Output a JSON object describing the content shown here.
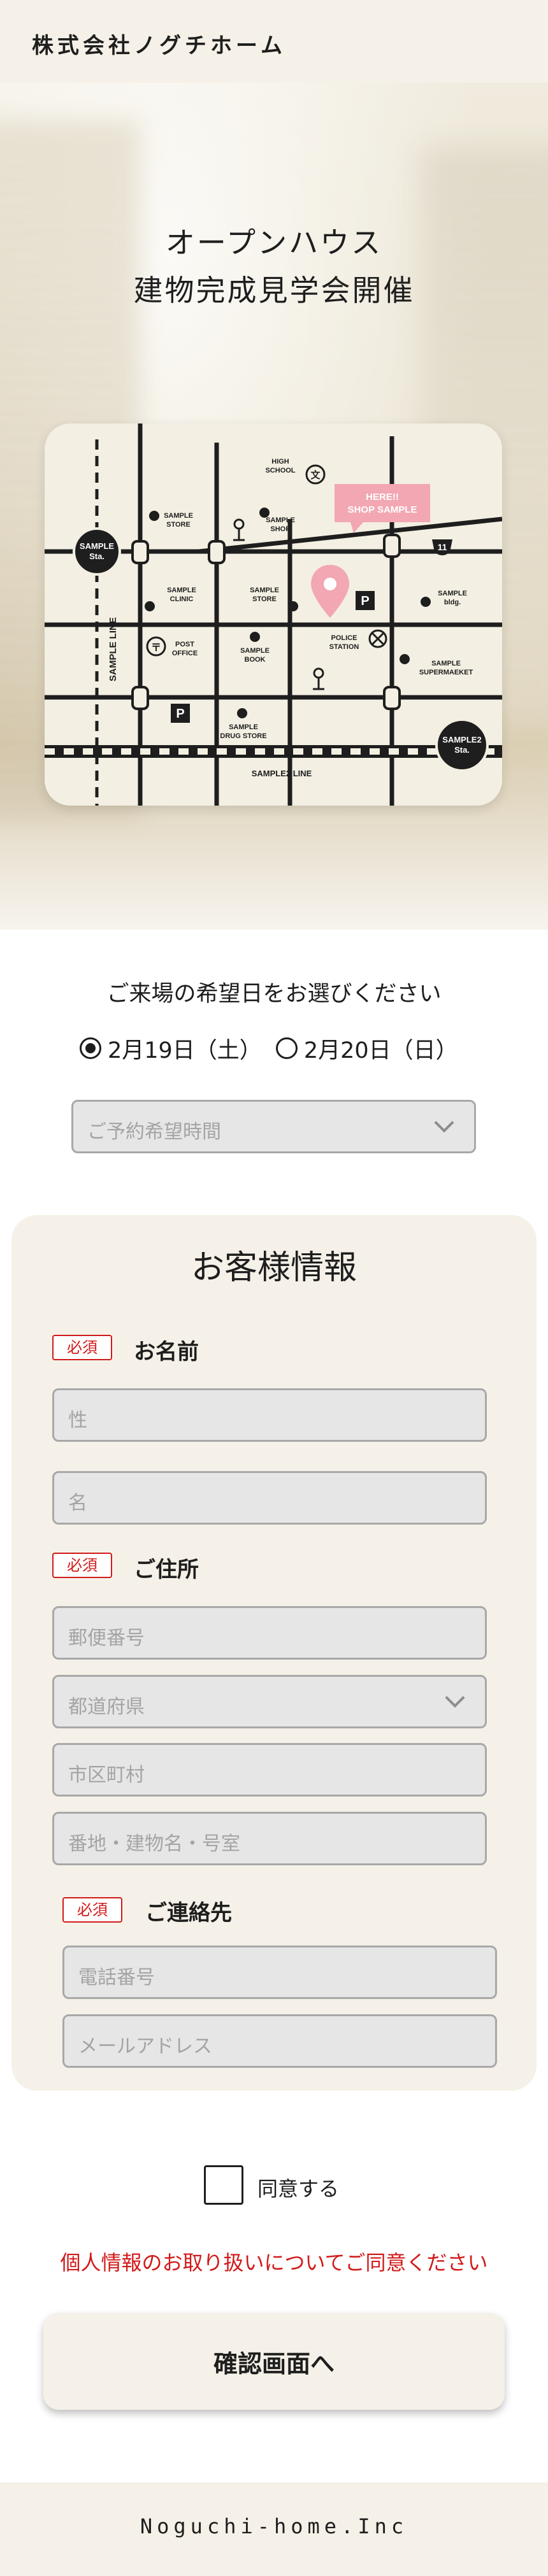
{
  "header": {
    "logo": "株式会社ノグチホーム"
  },
  "hero": {
    "line1": "オープンハウス",
    "line2": "建物完成見学会開催",
    "map": {
      "labels": {
        "sample_sta": [
          "SAMPLE",
          "Sta."
        ],
        "sample2_sta": [
          "SAMPLE2",
          "Sta."
        ],
        "sample_line": "SAMPLE LINE",
        "sample2_line": "SAMPLE2 LINE",
        "high_school": [
          "HIGH",
          "SCHOOL"
        ],
        "sample_store_1": [
          "SAMPLE",
          "STORE"
        ],
        "sample_shop": [
          "SAMPLE",
          "SHOP"
        ],
        "here": [
          "HERE!!",
          "SHOP SAMPLE"
        ],
        "route_number": "11",
        "sample_clinic": [
          "SAMPLE",
          "CLINIC"
        ],
        "sample_store_2": [
          "SAMPLE",
          "STORE"
        ],
        "sample_bldg": [
          "SAMPLE",
          "bldg."
        ],
        "post_office": [
          "POST",
          "OFFICE"
        ],
        "sample_book": [
          "SAMPLE",
          "BOOK"
        ],
        "police_station": [
          "POLICE",
          "STATION"
        ],
        "sample_supermarket": [
          "SAMPLE",
          "SUPERMAEKET"
        ],
        "sample_drug_store": [
          "SAMPLE",
          "DRUG STORE"
        ],
        "parking": "P"
      },
      "colors": {
        "pin": "#f2a7b2",
        "road": "#1e1e1e",
        "bg": "#f3efe2"
      }
    }
  },
  "date_section": {
    "question": "ご来場の希望日をお選びください",
    "options": [
      {
        "label": "2月19日（土）",
        "selected": true
      },
      {
        "label": "2月20日（日）",
        "selected": false
      }
    ],
    "time_placeholder": "ご予約希望時間"
  },
  "customer_info": {
    "title": "お客様情報",
    "required_badge": "必須",
    "name": {
      "label": "お名前",
      "last_placeholder": "性",
      "first_placeholder": "名"
    },
    "address": {
      "label": "ご住所",
      "postal_placeholder": "郵便番号",
      "prefecture_placeholder": "都道府県",
      "city_placeholder": "市区町村",
      "street_placeholder": "番地・建物名・号室"
    },
    "contact": {
      "label": "ご連絡先",
      "phone_placeholder": "電話番号",
      "email_placeholder": "メールアドレス"
    }
  },
  "agreement": {
    "checkbox_label": "同意する",
    "warning": "個人情報のお取り扱いについてご同意ください",
    "checked": false
  },
  "confirm_button": "確認画面へ",
  "footer": {
    "text": "Noguchi-home.Inc"
  },
  "colors": {
    "accent_red": "#d21a1a",
    "cream": "#f5f1e8"
  }
}
